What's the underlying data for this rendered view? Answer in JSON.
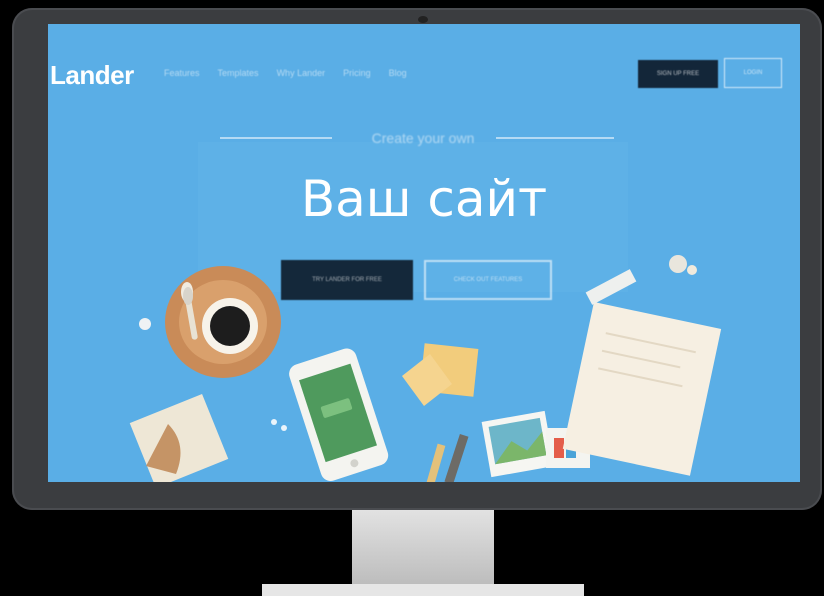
{
  "site": {
    "logo": "Lander",
    "nav_links": [
      "Features",
      "Templates",
      "Why Lander",
      "Pricing",
      "Blog"
    ],
    "signup_label": "SIGN UP FREE",
    "login_label": "LOGIN"
  },
  "hero": {
    "tagline": "Create your own",
    "title": "Ваш сайт",
    "cta_primary": "TRY LANDER FOR FREE",
    "cta_secondary": "CHECK OUT FEATURES"
  },
  "colors": {
    "screen_bg": "#5aaee6",
    "dark_button": "#132639",
    "bezel": "#3b3d40"
  }
}
